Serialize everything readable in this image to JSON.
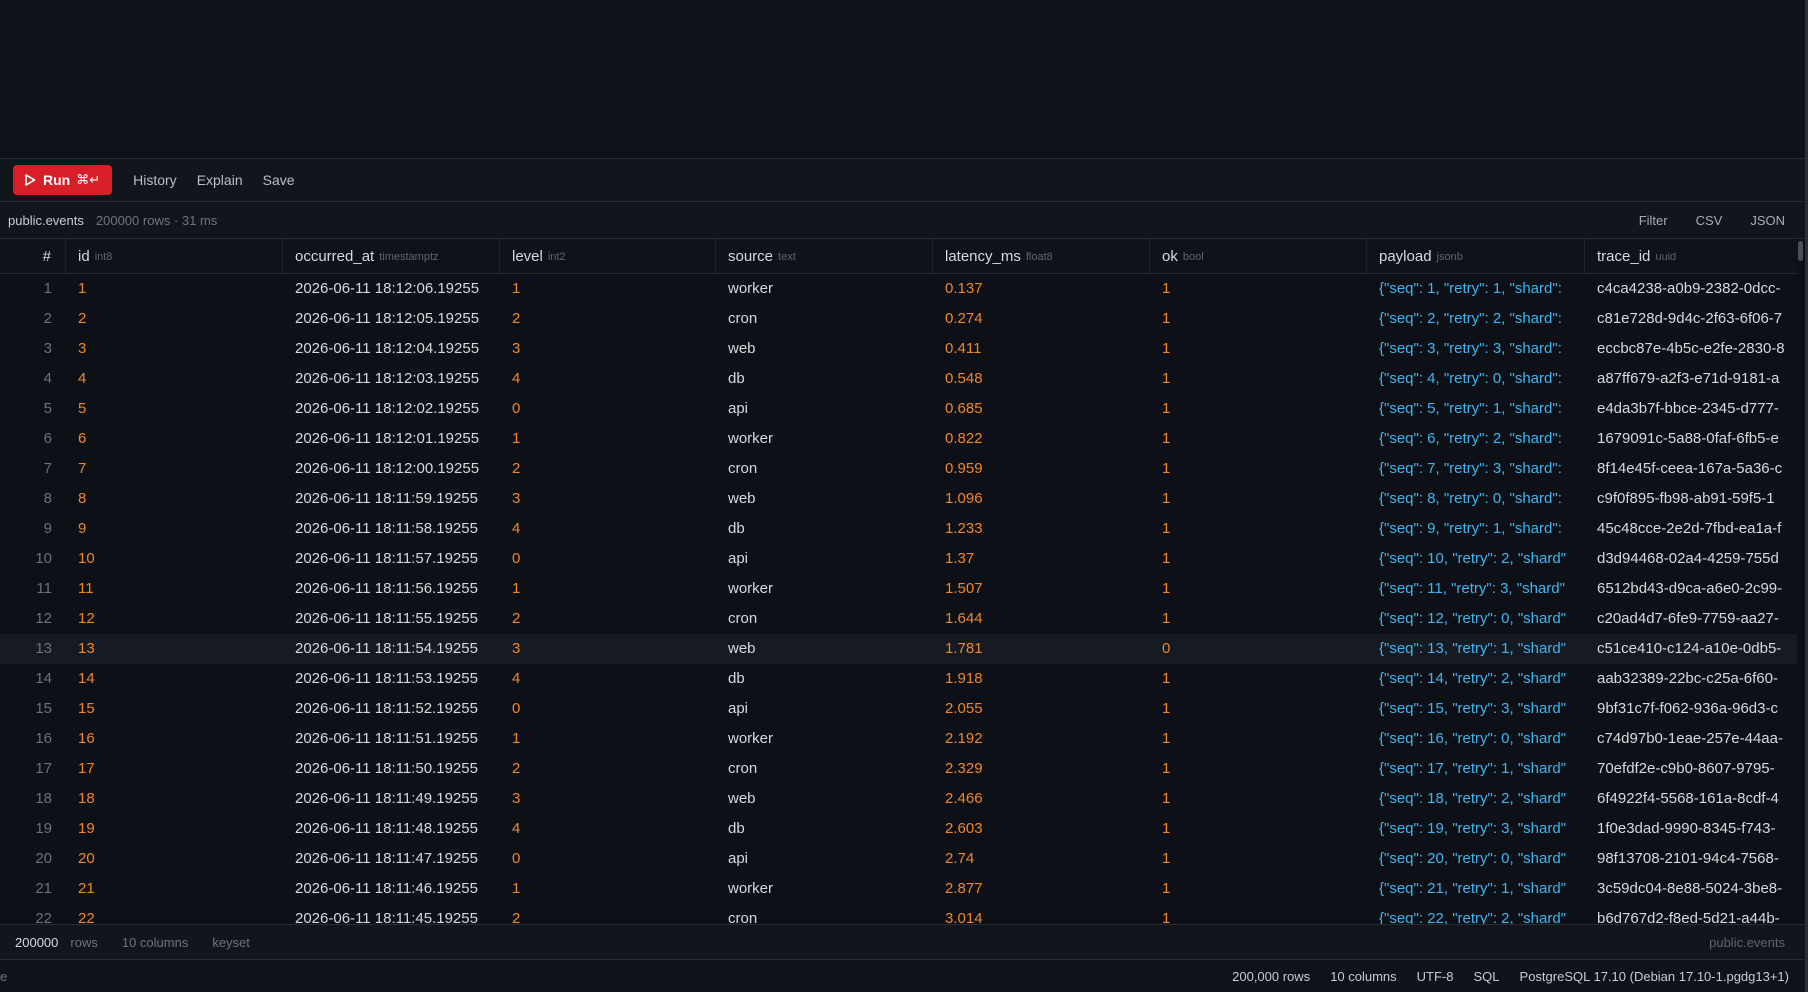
{
  "toolbar": {
    "run_label": "Run",
    "run_shortcut": "⌘↵",
    "history_label": "History",
    "explain_label": "Explain",
    "save_label": "Save"
  },
  "infobar": {
    "table_name": "public.events",
    "meta": "200000 rows · 31 ms",
    "filter_label": "Filter",
    "csv_label": "CSV",
    "json_label": "JSON"
  },
  "columns": [
    {
      "name": "#",
      "type": ""
    },
    {
      "name": "id",
      "type": "int8"
    },
    {
      "name": "occurred_at",
      "type": "timestamptz"
    },
    {
      "name": "level",
      "type": "int2"
    },
    {
      "name": "source",
      "type": "text"
    },
    {
      "name": "latency_ms",
      "type": "float8"
    },
    {
      "name": "ok",
      "type": "bool"
    },
    {
      "name": "payload",
      "type": "jsonb"
    },
    {
      "name": "trace_id",
      "type": "uuid"
    }
  ],
  "rows": [
    [
      "1",
      "1",
      "2026-06-11 18:12:06.19255",
      "1",
      "worker",
      "0.137",
      "1",
      "{\"seq\": 1, \"retry\": 1, \"shard\":",
      "c4ca4238-a0b9-2382-0dcc-"
    ],
    [
      "2",
      "2",
      "2026-06-11 18:12:05.19255",
      "2",
      "cron",
      "0.274",
      "1",
      "{\"seq\": 2, \"retry\": 2, \"shard\":",
      "c81e728d-9d4c-2f63-6f06-7"
    ],
    [
      "3",
      "3",
      "2026-06-11 18:12:04.19255",
      "3",
      "web",
      "0.411",
      "1",
      "{\"seq\": 3, \"retry\": 3, \"shard\":",
      "eccbc87e-4b5c-e2fe-2830-8"
    ],
    [
      "4",
      "4",
      "2026-06-11 18:12:03.19255",
      "4",
      "db",
      "0.548",
      "1",
      "{\"seq\": 4, \"retry\": 0, \"shard\":",
      "a87ff679-a2f3-e71d-9181-a"
    ],
    [
      "5",
      "5",
      "2026-06-11 18:12:02.19255",
      "0",
      "api",
      "0.685",
      "1",
      "{\"seq\": 5, \"retry\": 1, \"shard\":",
      "e4da3b7f-bbce-2345-d777-"
    ],
    [
      "6",
      "6",
      "2026-06-11 18:12:01.19255",
      "1",
      "worker",
      "0.822",
      "1",
      "{\"seq\": 6, \"retry\": 2, \"shard\":",
      "1679091c-5a88-0faf-6fb5-e"
    ],
    [
      "7",
      "7",
      "2026-06-11 18:12:00.19255",
      "2",
      "cron",
      "0.959",
      "1",
      "{\"seq\": 7, \"retry\": 3, \"shard\":",
      "8f14e45f-ceea-167a-5a36-c"
    ],
    [
      "8",
      "8",
      "2026-06-11 18:11:59.19255",
      "3",
      "web",
      "1.096",
      "1",
      "{\"seq\": 8, \"retry\": 0, \"shard\":",
      "c9f0f895-fb98-ab91-59f5-1"
    ],
    [
      "9",
      "9",
      "2026-06-11 18:11:58.19255",
      "4",
      "db",
      "1.233",
      "1",
      "{\"seq\": 9, \"retry\": 1, \"shard\":",
      "45c48cce-2e2d-7fbd-ea1a-f"
    ],
    [
      "10",
      "10",
      "2026-06-11 18:11:57.19255",
      "0",
      "api",
      "1.37",
      "1",
      "{\"seq\": 10, \"retry\": 2, \"shard\"",
      "d3d94468-02a4-4259-755d"
    ],
    [
      "11",
      "11",
      "2026-06-11 18:11:56.19255",
      "1",
      "worker",
      "1.507",
      "1",
      "{\"seq\": 11, \"retry\": 3, \"shard\"",
      "6512bd43-d9ca-a6e0-2c99-"
    ],
    [
      "12",
      "12",
      "2026-06-11 18:11:55.19255",
      "2",
      "cron",
      "1.644",
      "1",
      "{\"seq\": 12, \"retry\": 0, \"shard\"",
      "c20ad4d7-6fe9-7759-aa27-"
    ],
    [
      "13",
      "13",
      "2026-06-11 18:11:54.19255",
      "3",
      "web",
      "1.781",
      "0",
      "{\"seq\": 13, \"retry\": 1, \"shard\"",
      "c51ce410-c124-a10e-0db5-"
    ],
    [
      "14",
      "14",
      "2026-06-11 18:11:53.19255",
      "4",
      "db",
      "1.918",
      "1",
      "{\"seq\": 14, \"retry\": 2, \"shard\"",
      "aab32389-22bc-c25a-6f60-"
    ],
    [
      "15",
      "15",
      "2026-06-11 18:11:52.19255",
      "0",
      "api",
      "2.055",
      "1",
      "{\"seq\": 15, \"retry\": 3, \"shard\"",
      "9bf31c7f-f062-936a-96d3-c"
    ],
    [
      "16",
      "16",
      "2026-06-11 18:11:51.19255",
      "1",
      "worker",
      "2.192",
      "1",
      "{\"seq\": 16, \"retry\": 0, \"shard\"",
      "c74d97b0-1eae-257e-44aa-"
    ],
    [
      "17",
      "17",
      "2026-06-11 18:11:50.19255",
      "2",
      "cron",
      "2.329",
      "1",
      "{\"seq\": 17, \"retry\": 1, \"shard\"",
      "70efdf2e-c9b0-8607-9795-"
    ],
    [
      "18",
      "18",
      "2026-06-11 18:11:49.19255",
      "3",
      "web",
      "2.466",
      "1",
      "{\"seq\": 18, \"retry\": 2, \"shard\"",
      "6f4922f4-5568-161a-8cdf-4"
    ],
    [
      "19",
      "19",
      "2026-06-11 18:11:48.19255",
      "4",
      "db",
      "2.603",
      "1",
      "{\"seq\": 19, \"retry\": 3, \"shard\"",
      "1f0e3dad-9990-8345-f743-"
    ],
    [
      "20",
      "20",
      "2026-06-11 18:11:47.19255",
      "0",
      "api",
      "2.74",
      "1",
      "{\"seq\": 20, \"retry\": 0, \"shard\"",
      "98f13708-2101-94c4-7568-"
    ],
    [
      "21",
      "21",
      "2026-06-11 18:11:46.19255",
      "1",
      "worker",
      "2.877",
      "1",
      "{\"seq\": 21, \"retry\": 1, \"shard\"",
      "3c59dc04-8e88-5024-3be8-"
    ],
    [
      "22",
      "22",
      "2026-06-11 18:11:45.19255",
      "2",
      "cron",
      "3.014",
      "1",
      "{\"seq\": 22, \"retry\": 2, \"shard\"",
      "b6d767d2-f8ed-5d21-a44b-"
    ]
  ],
  "highlighted_row": 13,
  "footer": {
    "row_count": "200000",
    "rows_label": "rows",
    "columns_label": "10 columns",
    "mode_label": "keyset",
    "table_name": "public.events"
  },
  "statusbar": {
    "left_fragment": "e",
    "rows": "200,000 rows",
    "columns": "10 columns",
    "encoding": "UTF-8",
    "language": "SQL",
    "server": "PostgreSQL 17.10 (Debian 17.10-1.pgdg13+1)"
  },
  "colors": {
    "accent_red": "#d81e28",
    "number_orange": "#f0862a",
    "json_blue": "#3fb6f0"
  }
}
